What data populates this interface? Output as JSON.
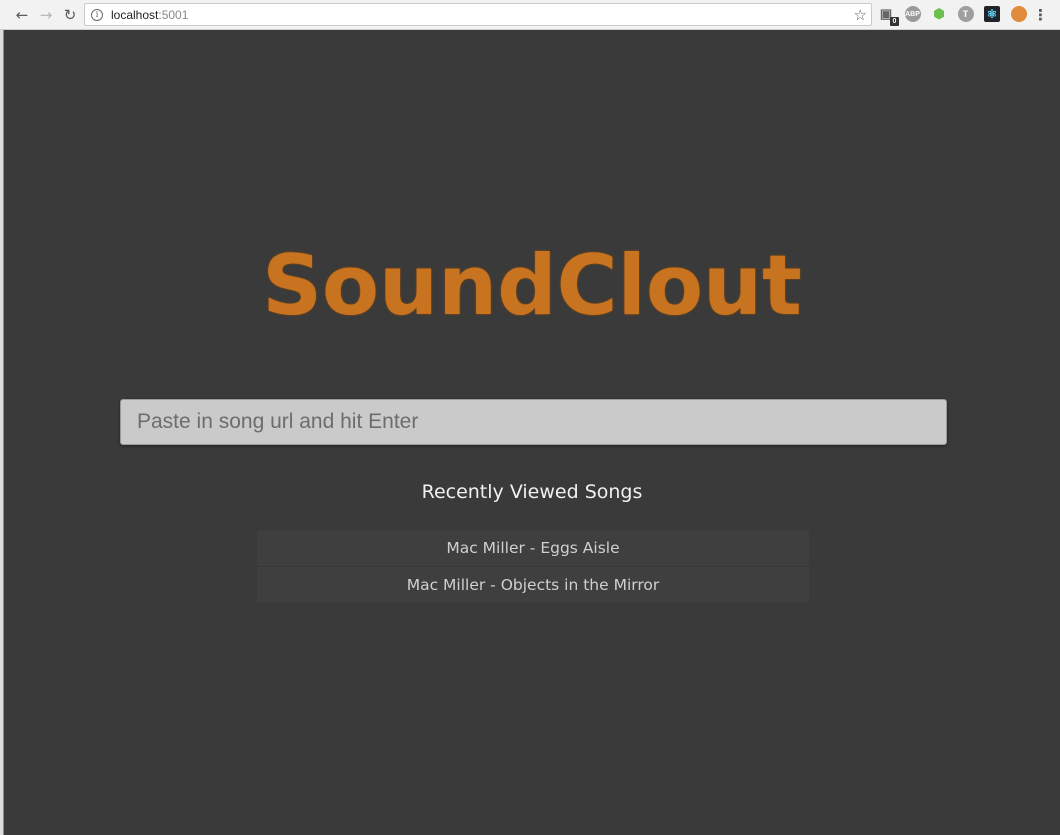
{
  "browser": {
    "url_host": "localhost",
    "url_port": ":5001",
    "extensions": [
      {
        "name": "ghostery-icon",
        "label": "0"
      },
      {
        "name": "adblock-plus-icon",
        "label": "ABP"
      },
      {
        "name": "nodejs-icon",
        "label": "⬢"
      },
      {
        "name": "t-extension-icon",
        "label": "T"
      },
      {
        "name": "react-devtools-icon",
        "label": "⚛"
      },
      {
        "name": "cookie-icon",
        "label": ""
      }
    ]
  },
  "app": {
    "logo_text": "SoundClout",
    "search_placeholder": "Paste in song url and hit Enter",
    "recent_heading": "Recently Viewed Songs",
    "recent_songs": [
      "Mac Miller - Eggs Aisle",
      "Mac Miller - Objects in the Mirror"
    ]
  },
  "colors": {
    "page_background": "#3a3a3a",
    "logo_orange": "#c7731f",
    "search_background": "#cacaca"
  }
}
